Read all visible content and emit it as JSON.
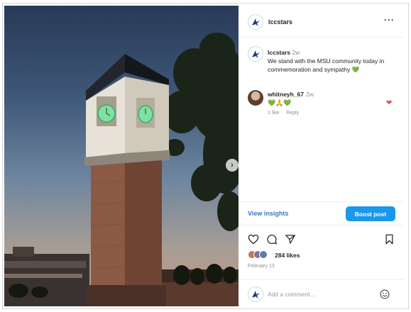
{
  "post": {
    "author": "lccstars",
    "more_label": "···",
    "caption": {
      "username": "lccstars",
      "time": "2w",
      "text": "We stand with the MSU community today in commemoration and sympathy",
      "emoji": "💚"
    },
    "comment": {
      "username": "whitneyh_67",
      "time": "2w",
      "emoji": "💚🙏💚",
      "likes_label": "1 like",
      "reply_label": "Reply",
      "liked_icon": "heart-filled-icon"
    },
    "view_insights_label": "View insights",
    "boost_label": "Boost post",
    "likes_count": "284 likes",
    "date": "February 13",
    "add_comment_placeholder": "Add a comment…",
    "next_icon": "chevron-right-icon"
  },
  "colors": {
    "accent_blue": "#1a98ea",
    "link_blue": "#3a75c4",
    "heart_red": "#ed4956",
    "clock_green": "#7ee0a1"
  }
}
